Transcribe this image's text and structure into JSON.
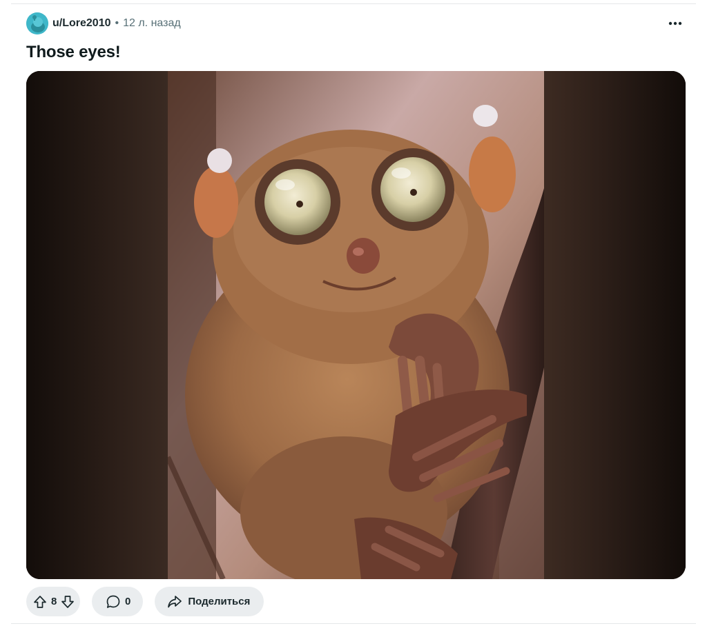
{
  "post": {
    "author": "u/Lore2010",
    "separator": "•",
    "age": "12 л. назад",
    "title": "Those eyes!",
    "image_alt": "tarsier photo"
  },
  "actions": {
    "vote_count": "8",
    "comment_count": "0",
    "share_label": "Поделиться"
  },
  "icons": {
    "more": "more-horizontal-icon",
    "upvote": "arrow-up-icon",
    "downvote": "arrow-down-icon",
    "comment": "speech-bubble-icon",
    "share": "share-arrow-icon"
  },
  "colors": {
    "avatar": "#3fb7c9",
    "pill_bg": "#eaedef",
    "muted_text": "#576f76"
  }
}
